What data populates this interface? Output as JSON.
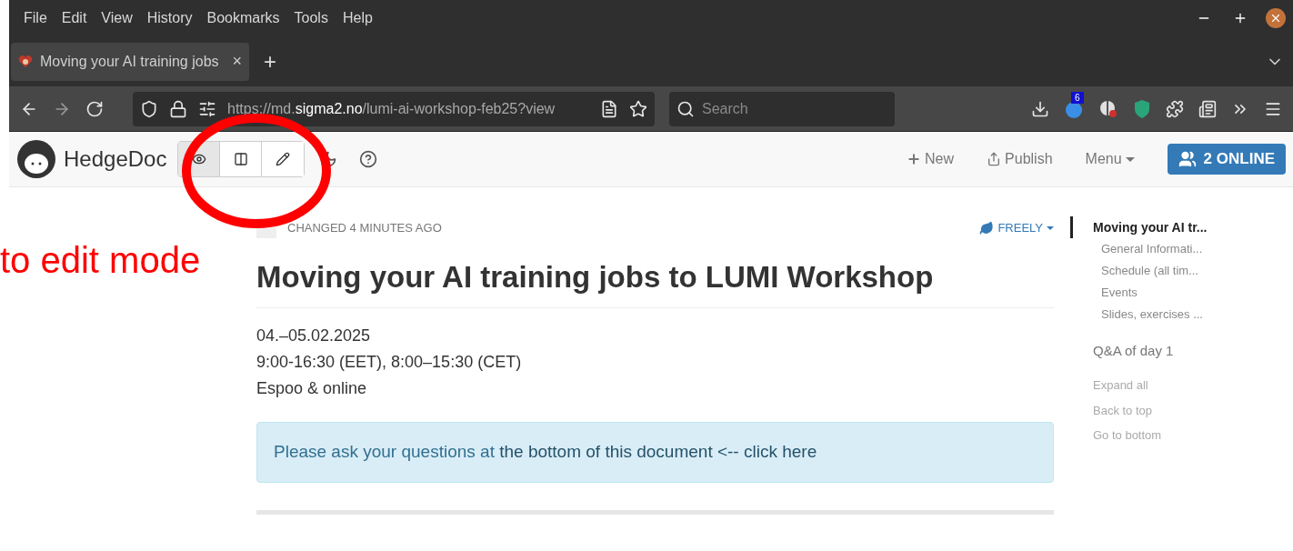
{
  "menu_bar": [
    "File",
    "Edit",
    "View",
    "History",
    "Bookmarks",
    "Tools",
    "Help"
  ],
  "tabs": [
    {
      "title": "Moving your AI training jobs",
      "selected": true,
      "close": "×"
    }
  ],
  "new_tab": "+",
  "address_bar": {
    "scheme": "https://md.",
    "host": "sigma2.no",
    "path": "/lumi-ai-workshop-feb25?view"
  },
  "search": {
    "placeholder": "Search"
  },
  "extension_badge": "6",
  "app_nav": {
    "brand": "HedgeDoc",
    "modes": [
      {
        "kind": "view",
        "selected": true
      },
      {
        "kind": "both",
        "selected": false
      },
      {
        "kind": "edit",
        "selected": false
      }
    ],
    "new": "New",
    "publish": "Publish",
    "menu": "Menu",
    "online": "2 ONLINE"
  },
  "annotation": "to edit mode",
  "document": {
    "changed": "CHANGED 4 MINUTES AGO",
    "permission": "FREELY",
    "title": "Moving your AI training jobs to LUMI Workshop",
    "lines": [
      "04.–05.02.2025",
      "9:00-16:30 (EET), 8:00–15:30 (CET)",
      "Espoo & online"
    ],
    "alert": {
      "text": "Please ask your questions at ",
      "link": "the bottom of this document <-- click here"
    }
  },
  "toc": {
    "items": [
      {
        "label": "Moving your AI tr...",
        "selected": true,
        "children": [
          {
            "label": "General Informati..."
          },
          {
            "label": "Schedule (all tim..."
          },
          {
            "label": "Events"
          },
          {
            "label": "Slides, exercises ..."
          }
        ]
      },
      {
        "label": "Q&A of day 1",
        "selected": false
      }
    ],
    "links": [
      "Expand all",
      "Back to top",
      "Go to bottom"
    ]
  }
}
